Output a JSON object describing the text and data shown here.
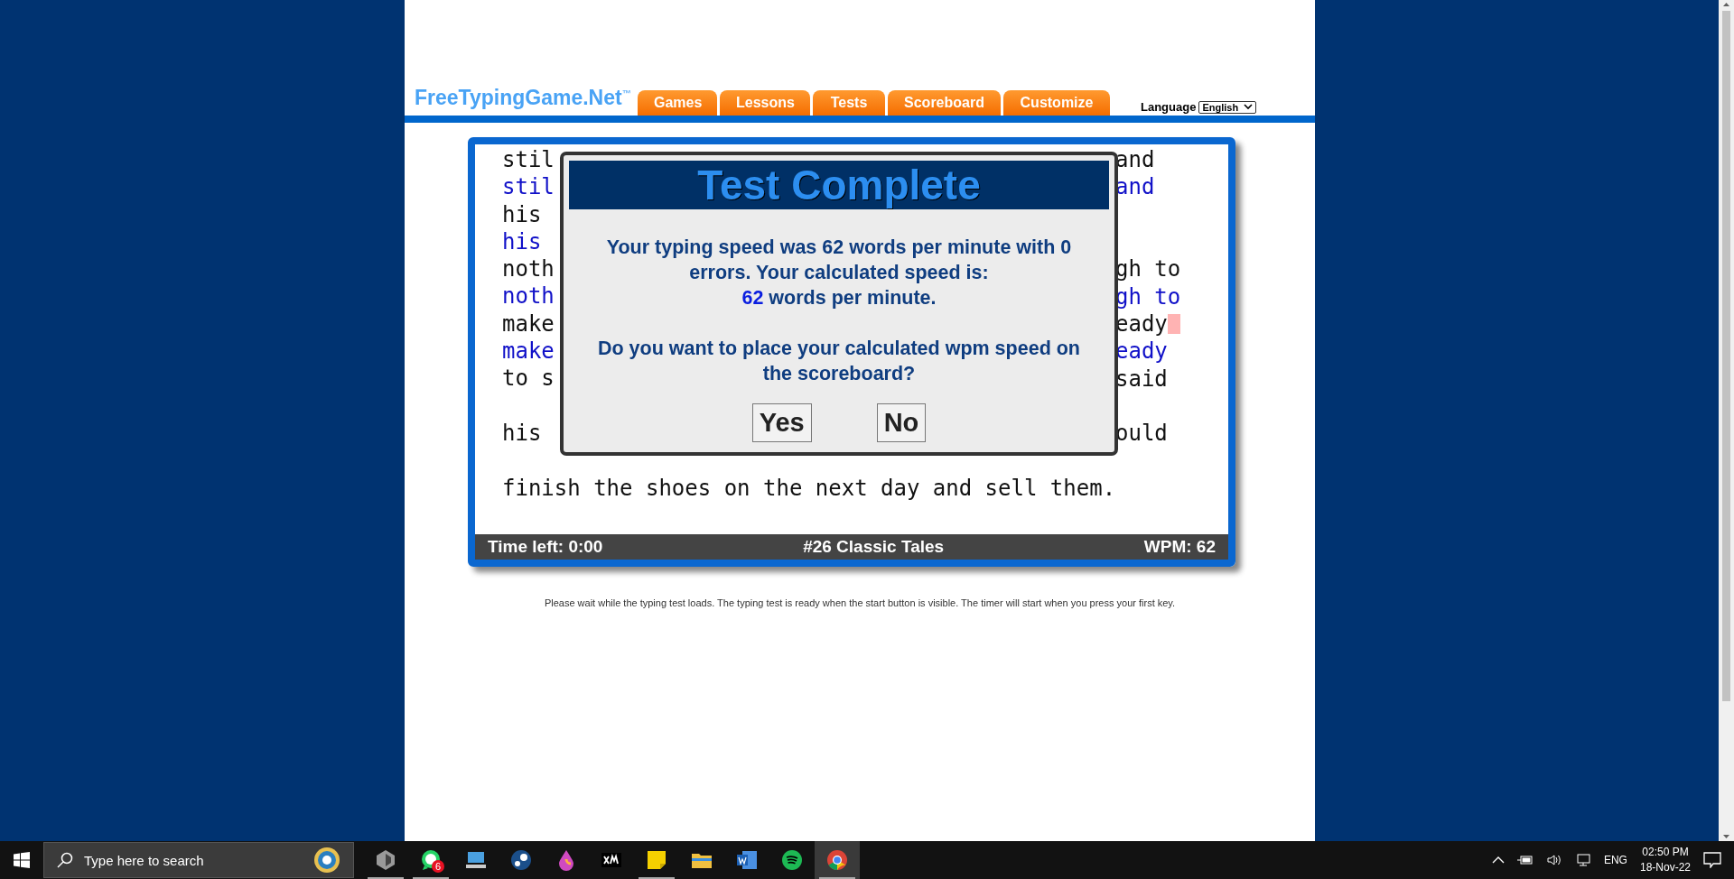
{
  "header": {
    "logo": "FreeTypingGame.Net",
    "logo_mark": "™",
    "tabs": [
      {
        "label": "Games"
      },
      {
        "label": "Lessons"
      },
      {
        "label": "Tests"
      },
      {
        "label": "Scoreboard"
      },
      {
        "label": "Customize"
      }
    ],
    "language": {
      "label": "Language",
      "value": "English"
    }
  },
  "typing": {
    "lines": [
      {
        "kind": "source",
        "left": "stil",
        "right": "and",
        "cursor": false
      },
      {
        "kind": "typed",
        "left": "stil",
        "right": "and",
        "cursor": false
      },
      {
        "kind": "source",
        "left": "his",
        "cursor": false
      },
      {
        "kind": "typed",
        "left": "his",
        "cursor": false
      },
      {
        "kind": "source",
        "left": "noth",
        "right": "gh to",
        "cursor": false
      },
      {
        "kind": "typed",
        "left": "noth",
        "right": "gh to",
        "cursor": false
      },
      {
        "kind": "source",
        "left": "make",
        "right": "eady",
        "cursor": true
      },
      {
        "kind": "typed",
        "left": "make",
        "right": "eady",
        "cursor": false
      },
      {
        "kind": "source",
        "left": "to s",
        "right": "said",
        "cursor": false
      },
      {
        "kind": "blank"
      },
      {
        "kind": "source",
        "left": "his",
        "right": "ould",
        "cursor": false
      },
      {
        "kind": "blank"
      },
      {
        "kind": "source",
        "left": "finish the shoes on the next day and sell them.",
        "cursor": false
      }
    ]
  },
  "dialog": {
    "title": "Test Complete",
    "message": "Your typing speed was 62 words per minute with 0 errors. Your calculated speed is:",
    "speed": "62",
    "speed_unit": "words per minute.",
    "question": "Do you want to place your calculated wpm speed on the scoreboard?",
    "buttons": [
      "Yes",
      "No"
    ]
  },
  "status_bar": {
    "time_left": "Time left: 0:00",
    "title": "#26 Classic Tales",
    "wpm": "WPM: 62"
  },
  "footnote": "Please wait while the typing test loads. The typing test is ready when the start button is visible. The timer will start when you press your first key.",
  "taskbar": {
    "search_placeholder": "Type here to search",
    "apps": [
      {
        "kind": "gem",
        "running": true,
        "selected": false
      },
      {
        "kind": "chat",
        "running": true,
        "selected": false,
        "badge": "6"
      },
      {
        "kind": "computer",
        "running": false,
        "selected": false
      },
      {
        "kind": "steam",
        "running": false,
        "selected": false
      },
      {
        "kind": "drop",
        "running": false,
        "selected": false
      },
      {
        "kind": "xm",
        "running": false,
        "selected": false
      },
      {
        "kind": "note",
        "running": true,
        "selected": false
      },
      {
        "kind": "folder",
        "running": false,
        "selected": false
      },
      {
        "kind": "word",
        "running": false,
        "selected": false
      },
      {
        "kind": "music",
        "running": false,
        "selected": false
      },
      {
        "kind": "browser",
        "running": true,
        "selected": true
      }
    ],
    "tray": {
      "language": "ENG",
      "time": "02:50 PM",
      "date": "18-Nov-22"
    }
  }
}
